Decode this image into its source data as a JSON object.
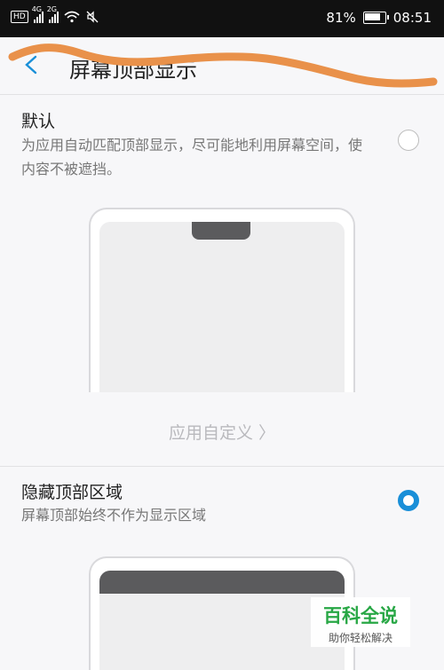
{
  "status_bar": {
    "hd": "HD",
    "sig1": "4G",
    "sig2": "2G",
    "battery": "81%",
    "time": "08:51"
  },
  "header": {
    "title": "屏幕顶部显示"
  },
  "options": [
    {
      "title": "默认",
      "desc": "为应用自动匹配顶部显示，尽可能地利用屏幕空间，使内容不被遮挡。",
      "selected": false
    },
    {
      "title": "隐藏顶部区域",
      "desc": "屏幕顶部始终不作为显示区域",
      "selected": true
    }
  ],
  "custom_link": "应用自定义 〉",
  "watermark": {
    "main": "百科全说",
    "sub": "助你轻松解决"
  },
  "colors": {
    "accent": "#1a8fd8",
    "scribble": "#e9914a"
  }
}
